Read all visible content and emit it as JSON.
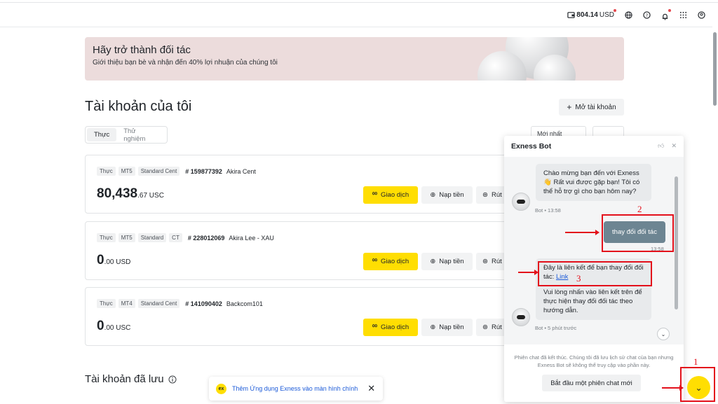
{
  "header": {
    "balance_value": "804.14",
    "balance_unit": "USD",
    "icons": [
      "wallet-icon",
      "globe-icon",
      "help-icon",
      "bell-icon",
      "apps-grid-icon",
      "profile-icon"
    ]
  },
  "promo": {
    "title": "Hãy trở thành đối tác",
    "subtitle": "Giới thiệu bạn bè và nhận đến 40% lợi nhuận của chúng tôi"
  },
  "accounts": {
    "title": "Tài khoản của tôi",
    "open_button": "Mở tài khoản",
    "tabs": [
      "Thực",
      "Thử nghiệm"
    ],
    "sort_label": "Mới nhất",
    "cards": [
      {
        "tags": [
          "Thực",
          "MT5",
          "Standard Cent"
        ],
        "number": "# 159877392",
        "name": "Akira Cent",
        "balance_int": "80,438",
        "balance_dec": ".67 USC"
      },
      {
        "tags": [
          "Thực",
          "MT5",
          "Standard",
          "CT"
        ],
        "number": "# 228012069",
        "name": "Akira Lee - XAU",
        "balance_int": "0",
        "balance_dec": ".00 USD"
      },
      {
        "tags": [
          "Thực",
          "MT4",
          "Standard Cent"
        ],
        "number": "# 141090402",
        "name": "Backcom101",
        "balance_int": "0",
        "balance_dec": ".00 USC"
      }
    ],
    "trade_label": "Giao dịch",
    "deposit_label": "Nạp tiền",
    "withdraw_label": "Rút"
  },
  "saved": {
    "title": "Tài khoản đã lưu"
  },
  "toast": {
    "text": "Thêm Ứng dụng Exness vào màn hình chính",
    "logo": "ex"
  },
  "chat": {
    "title": "Exness Bot",
    "msg1": "Chào mừng bạn đến với Exness 👋 Rất vui được gặp bạn! Tôi có thể hỗ trợ gì cho bạn hôm nay?",
    "msg1_meta": "Bot • 13:58",
    "user_msg": "thay đổi đối tác",
    "user_time": "13:58",
    "msg2_text": "Đây là liên kết để bạn thay đổi đối tác:",
    "msg2_link": "Link",
    "msg3": "Vui lòng nhấn vào liên kết trên để thực hiện thay đổi đối tác theo hướng dẫn.",
    "msg3_meta": "Bot • 5 phút trước",
    "ended_text": "Phiên chat đã kết thúc. Chúng tôi đã lưu lịch sử chat của bạn nhưng Exness Bot sẽ không thể truy cập vào phần này.",
    "new_chat_button": "Bắt đầu một phiên chat mới"
  },
  "annotations": {
    "n1": "1",
    "n2": "2",
    "n3": "3"
  },
  "colors": {
    "accent_yellow": "#ffde02",
    "annotation_red": "#e3101b",
    "user_bubble": "#6d8592"
  }
}
